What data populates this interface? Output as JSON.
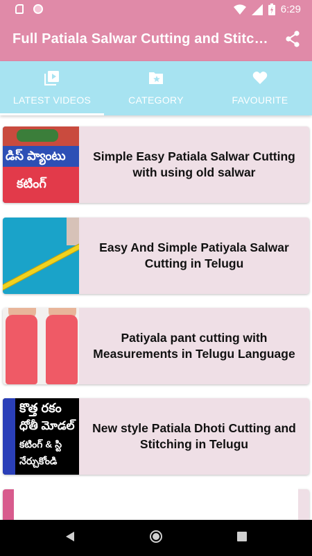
{
  "status_bar": {
    "time": "6:29",
    "icons": [
      "sd-card-icon",
      "circle-icon",
      "wifi-icon",
      "signal-icon",
      "battery-icon"
    ]
  },
  "app_bar": {
    "title": "Full Patiala Salwar Cutting and Stitching",
    "share_icon": "share-icon",
    "background": "#e08aa8"
  },
  "tabs": {
    "background": "#a7e3f1",
    "items": [
      {
        "label": "LATEST VIDEOS",
        "icon": "video-library-icon",
        "active": true
      },
      {
        "label": "CATEGORY",
        "icon": "folder-star-icon",
        "active": false
      },
      {
        "label": "FAVOURITE",
        "icon": "heart-icon",
        "active": false
      }
    ]
  },
  "videos": [
    {
      "title": "Simple Easy Patiala Salwar Cutting with using old salwar",
      "thumb_text": [
        "డిస్ ప్యాంటు",
        "కటింగ్"
      ]
    },
    {
      "title": "Easy And Simple Patiyala Salwar Cutting in Telugu"
    },
    {
      "title": "Patiyala pant cutting with Measurements in Telugu Language"
    },
    {
      "title": "New style Patiala Dhoti Cutting and Stitching in Telugu",
      "thumb_text": [
        "కొత్త రకం",
        "ధోతీ మోడల్",
        "కటింగ్ & స్టి",
        "నేర్చుకోండి"
      ]
    }
  ],
  "card_background": "#efdfe6",
  "nav_bar": {
    "icons": [
      "back-icon",
      "home-icon",
      "recents-icon"
    ]
  }
}
